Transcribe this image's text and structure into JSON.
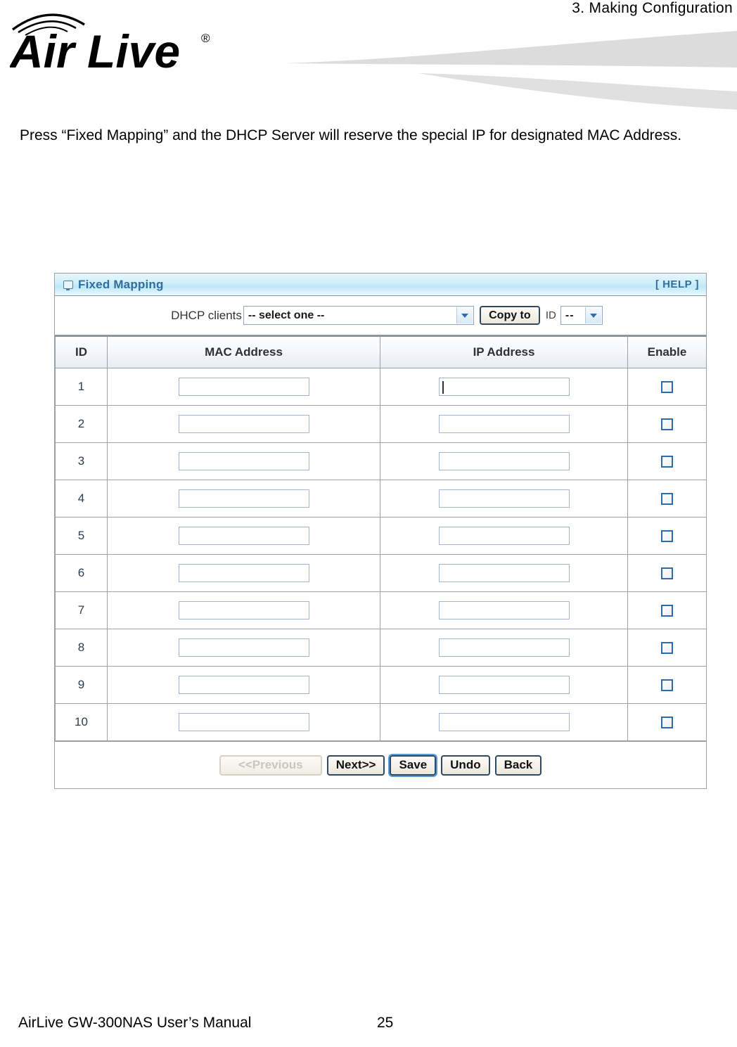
{
  "document": {
    "chapter_title": "3.  Making  Configuration",
    "logo_text": "Air Live",
    "logo_registered_mark": "®",
    "intro_paragraph": "Press “Fixed Mapping” and the DHCP Server will reserve the special IP for designated MAC Address.",
    "footer_manual": "AirLive GW-300NAS User’s Manual",
    "footer_page_number": "25"
  },
  "panel": {
    "title": "Fixed Mapping",
    "title_icon": "monitor-icon",
    "help_label": "[ HELP ]",
    "header_gradient_top": "#e8f7fd",
    "header_gradient_mid": "#bfe8f8",
    "title_color": "#2f6e9e"
  },
  "toolbar": {
    "dhcp_clients_label": "DHCP clients",
    "dhcp_clients_selected": "-- select one --",
    "dhcp_clients_options": [
      "-- select one --"
    ],
    "copy_to_label": "Copy to",
    "id_label": "ID",
    "id_selected": "--",
    "id_options": [
      "--"
    ],
    "dropdown_icon": "chevron-down-icon"
  },
  "table": {
    "columns": [
      "ID",
      "MAC Address",
      "IP Address",
      "Enable"
    ],
    "rows": [
      {
        "id": "1",
        "mac": "",
        "ip": "",
        "enabled": false,
        "ip_focused": true
      },
      {
        "id": "2",
        "mac": "",
        "ip": "",
        "enabled": false,
        "ip_focused": false
      },
      {
        "id": "3",
        "mac": "",
        "ip": "",
        "enabled": false,
        "ip_focused": false
      },
      {
        "id": "4",
        "mac": "",
        "ip": "",
        "enabled": false,
        "ip_focused": false
      },
      {
        "id": "5",
        "mac": "",
        "ip": "",
        "enabled": false,
        "ip_focused": false
      },
      {
        "id": "6",
        "mac": "",
        "ip": "",
        "enabled": false,
        "ip_focused": false
      },
      {
        "id": "7",
        "mac": "",
        "ip": "",
        "enabled": false,
        "ip_focused": false
      },
      {
        "id": "8",
        "mac": "",
        "ip": "",
        "enabled": false,
        "ip_focused": false
      },
      {
        "id": "9",
        "mac": "",
        "ip": "",
        "enabled": false,
        "ip_focused": false
      },
      {
        "id": "10",
        "mac": "",
        "ip": "",
        "enabled": false,
        "ip_focused": false
      }
    ]
  },
  "footer_buttons": [
    {
      "label": "<<Previous",
      "state": "disabled",
      "name": "previous-button"
    },
    {
      "label": "Next>>",
      "state": "enabled",
      "name": "next-button"
    },
    {
      "label": "Save",
      "state": "focused",
      "name": "save-button"
    },
    {
      "label": "Undo",
      "state": "enabled",
      "name": "undo-button"
    },
    {
      "label": "Back",
      "state": "enabled",
      "name": "back-button"
    }
  ]
}
